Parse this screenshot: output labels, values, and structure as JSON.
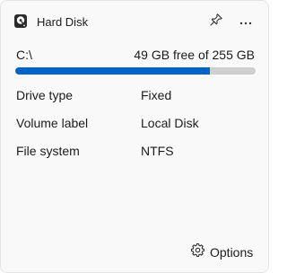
{
  "widget": {
    "title": "Hard Disk",
    "icons": {
      "app": "hard-disk-icon",
      "pin": "pin-icon",
      "more": "more-icon",
      "options": "gear-icon"
    }
  },
  "drive": {
    "path": "C:\\",
    "free_text": "49 GB free of 255 GB",
    "used_fraction": 0.81,
    "bar_color": "#0063c7",
    "track_color": "#cfcfcf"
  },
  "properties": [
    {
      "label": "Drive type",
      "value": "Fixed"
    },
    {
      "label": "Volume label",
      "value": "Local Disk"
    },
    {
      "label": "File system",
      "value": "NTFS"
    }
  ],
  "footer": {
    "options_label": "Options"
  }
}
